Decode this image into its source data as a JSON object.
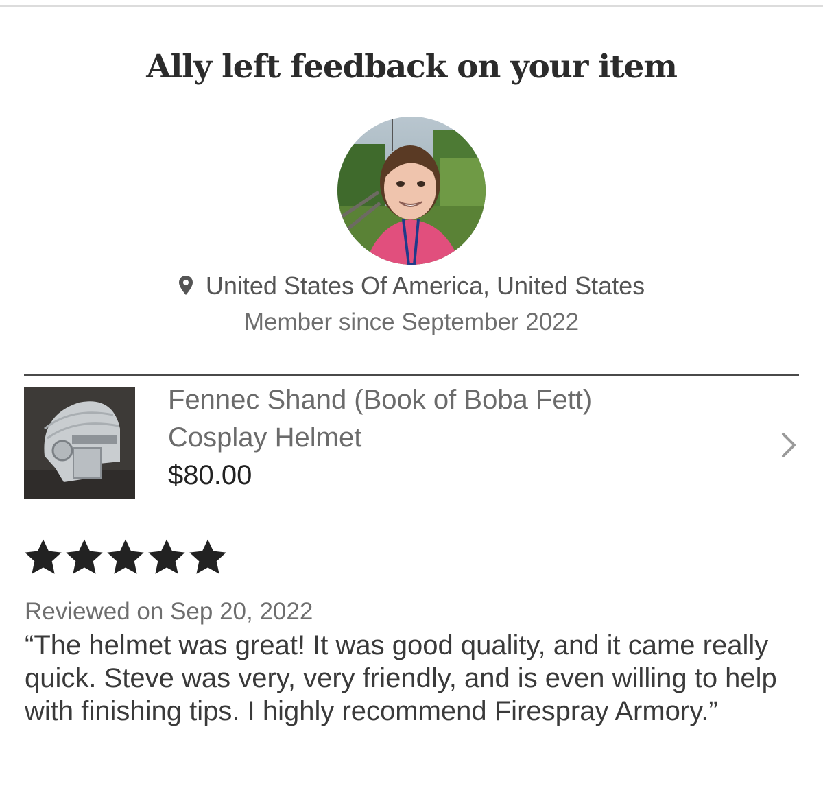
{
  "header": {
    "title": "Ally left feedback on your item"
  },
  "reviewer": {
    "avatar_icon": "user-avatar-photo",
    "location_icon": "map-pin-icon",
    "location": "United States Of America, United States",
    "member_since": "Member since September 2022"
  },
  "item": {
    "thumbnail_icon": "helmet-product-photo",
    "title_line1": "Fennec Shand (Book of Boba Fett)",
    "title_line2": "Cosplay Helmet",
    "price": "$80.00",
    "chevron_icon": "chevron-right-icon"
  },
  "review": {
    "rating": 5,
    "rating_max": 5,
    "date": "Reviewed on Sep 20, 2022",
    "text": "“The helmet was great! It was good quality, and it came really quick. Steve was very, very friendly, and is even willing to help with finishing tips. I highly recommend Firespray Armory.”"
  },
  "colors": {
    "text_dark": "#222222",
    "text_muted": "#6e6e6e",
    "star": "#222222"
  }
}
